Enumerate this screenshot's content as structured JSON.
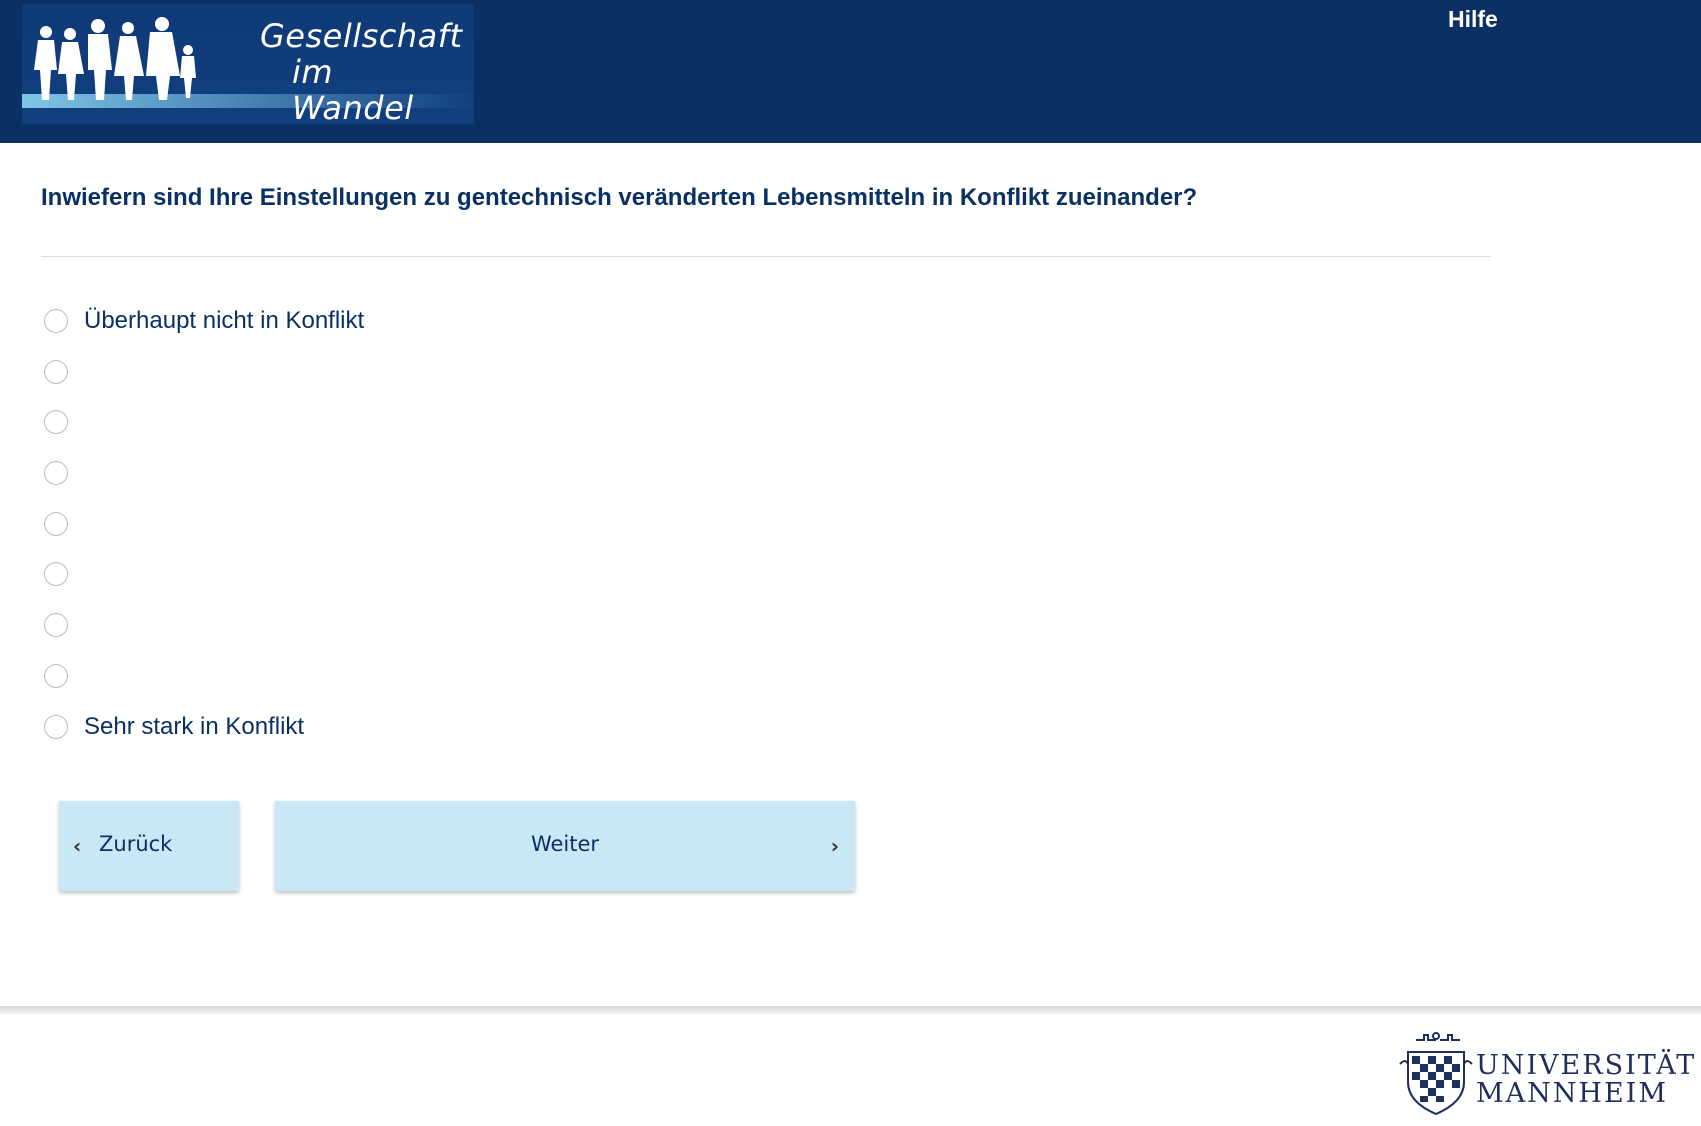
{
  "header": {
    "logo_line1": "Gesellschaft",
    "logo_line2": "im Wandel",
    "help_label": "Hilfe",
    "background_color": "#0b3064"
  },
  "question": {
    "text": "Inwiefern sind Ihre Einstellungen zu gentechnisch veränderten Lebensmitteln in Konflikt zueinander?"
  },
  "options": [
    {
      "label": "Überhaupt nicht in Konflikt",
      "selected": false
    },
    {
      "label": "",
      "selected": false
    },
    {
      "label": "",
      "selected": false
    },
    {
      "label": "",
      "selected": false
    },
    {
      "label": "",
      "selected": false
    },
    {
      "label": "",
      "selected": false
    },
    {
      "label": "",
      "selected": false
    },
    {
      "label": "",
      "selected": false
    },
    {
      "label": "Sehr stark in Konflikt",
      "selected": false
    }
  ],
  "navigation": {
    "back_label": "Zurück",
    "next_label": "Weiter",
    "button_color": "#c8e8f5"
  },
  "footer": {
    "university_line1": "UNIVERSITÄT",
    "university_line2": "MANNHEIM"
  }
}
